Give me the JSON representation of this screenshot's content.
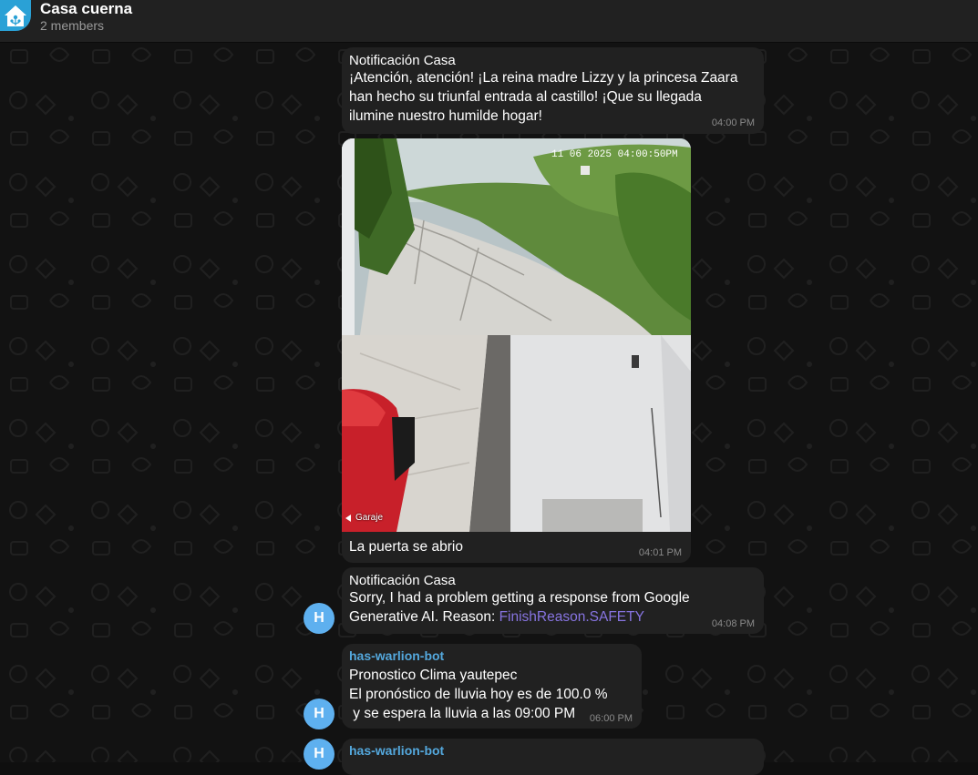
{
  "chat": {
    "title": "Casa cuerna",
    "members": "2 members"
  },
  "messages": [
    {
      "sender": "Notificación Casa",
      "text": "¡Atención, atención! ¡La reina madre Lizzy y la princesa Zaara han hecho su triunfal entrada al castillo! ¡Que su llegada ilumine nuestro humilde hogar!",
      "time": "04:00 PM"
    },
    {
      "photo_timestamp": "11 06 2025 04:00:50PM",
      "photo_label": "Garaje",
      "caption": "La puerta se abrio",
      "time": "04:01 PM"
    },
    {
      "sender": "Notificación Casa",
      "text": "Sorry, I had a problem getting a response from Google Generative AI. Reason: ",
      "link": "FinishReason.SAFETY",
      "time": "04:08 PM",
      "avatar": "H"
    },
    {
      "sender": "has-warlion-bot",
      "line1": "Pronostico Clima yautepec",
      "line2": "El pronóstico de lluvia hoy es de 100.0 %",
      "line3": " y se espera la lluvia a las 09:00 PM",
      "time": "06:00 PM",
      "avatar": "H"
    },
    {
      "sender": "has-warlion-bot",
      "avatar": "H"
    }
  ],
  "icons": {
    "group": "home-assistant-icon",
    "play": "play-icon"
  }
}
